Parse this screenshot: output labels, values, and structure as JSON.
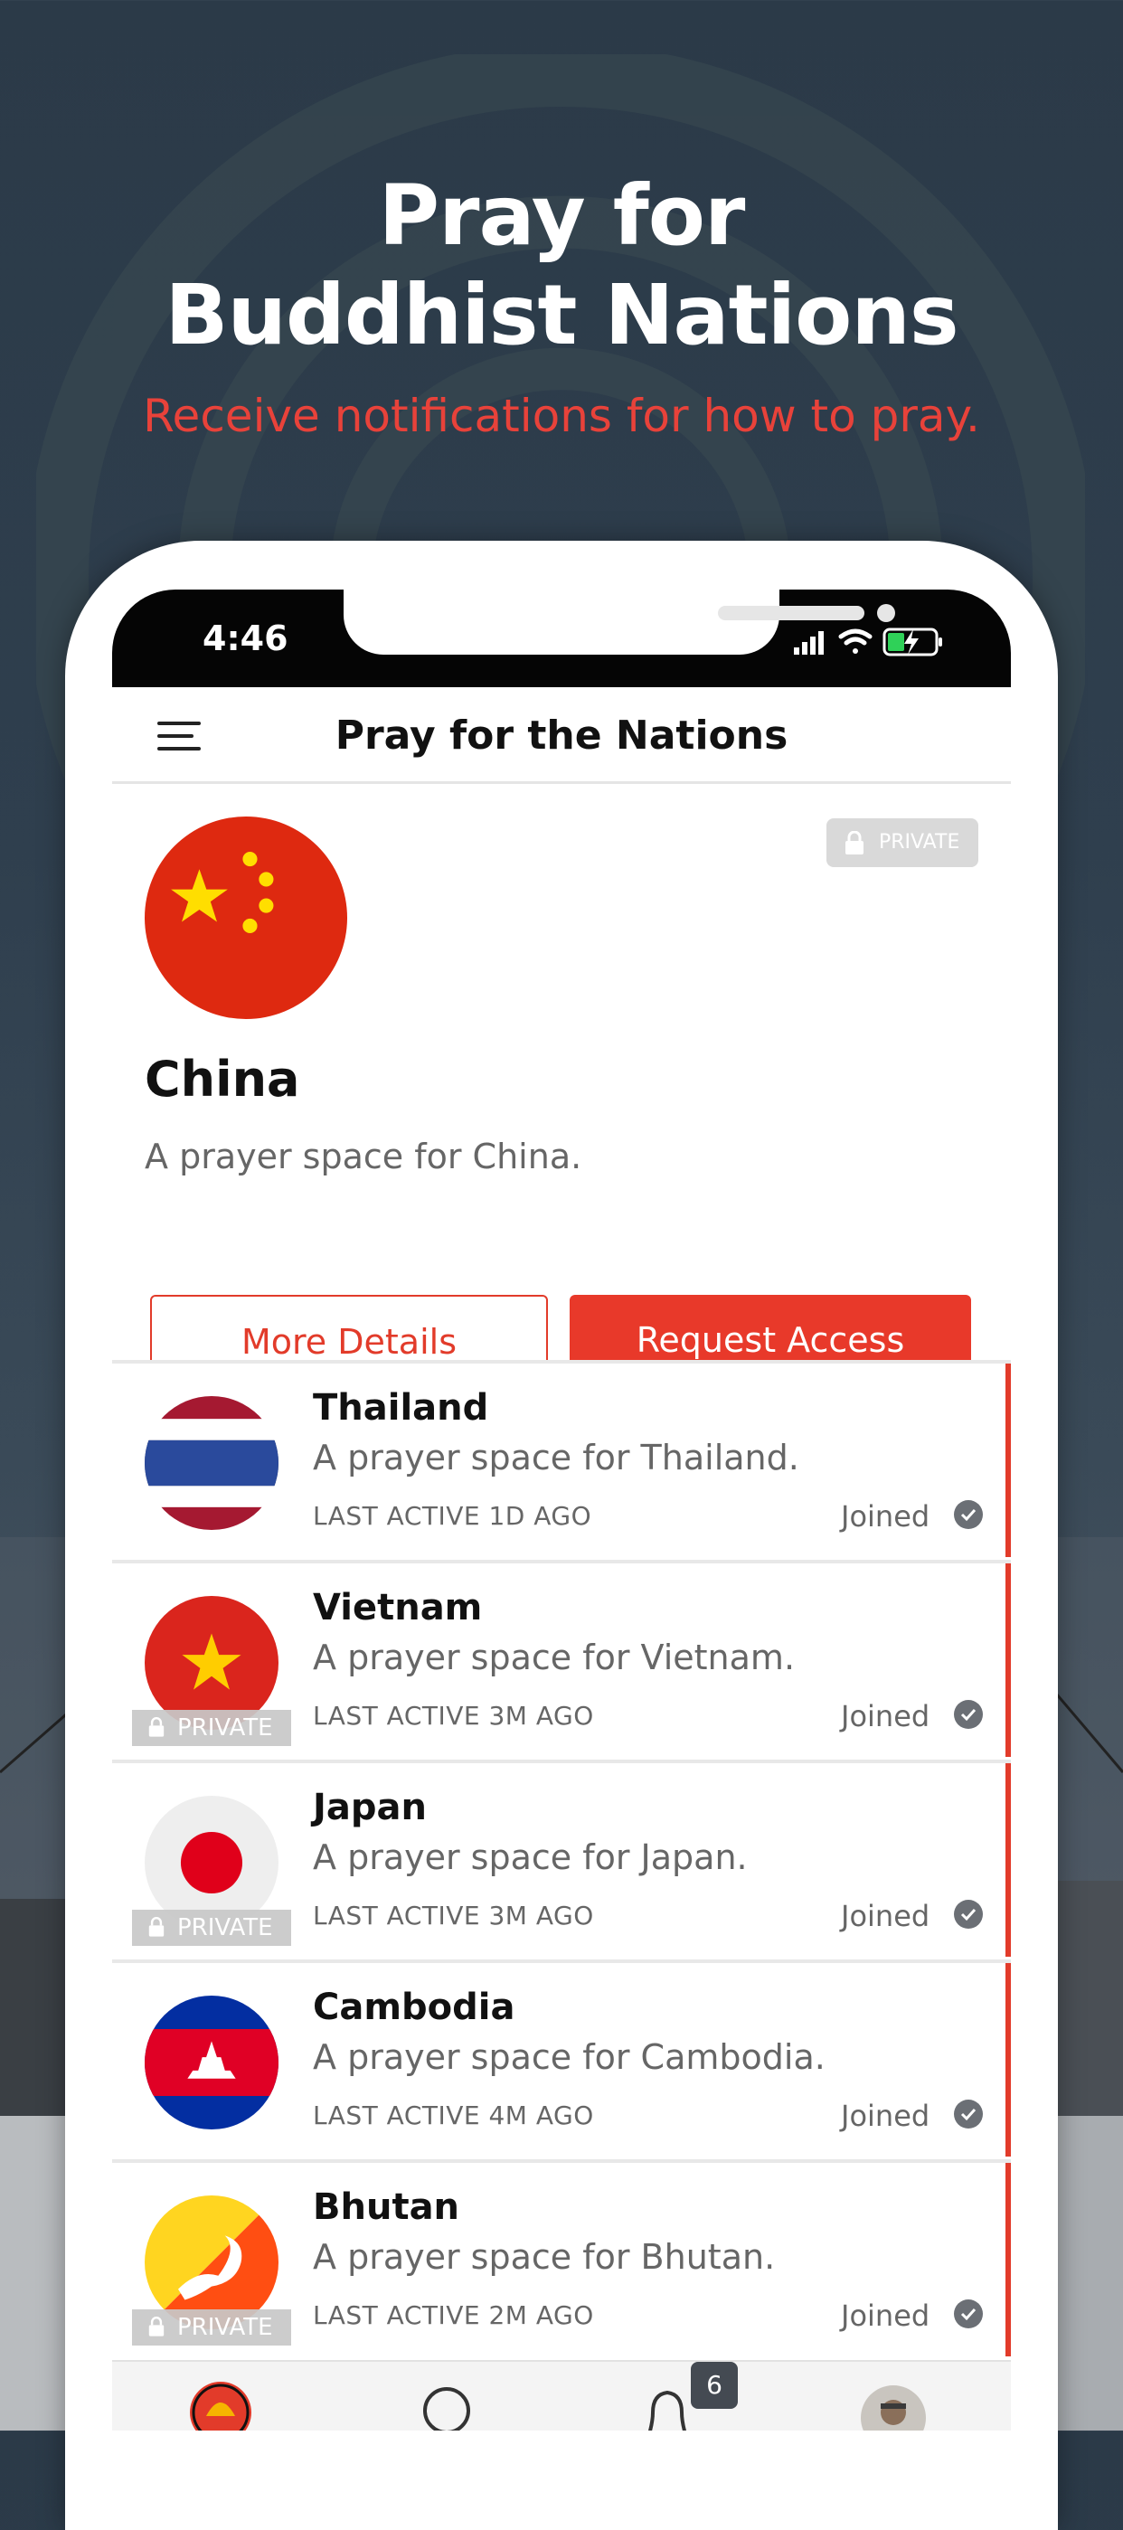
{
  "hero": {
    "title_line1": "Pray for",
    "title_line2": "Buddhist Nations",
    "subtitle": "Receive notifications for how to pray."
  },
  "status_bar": {
    "time": "4:46"
  },
  "nav": {
    "title": "Pray for the Nations"
  },
  "featured": {
    "name": "China",
    "description": "A prayer space for China.",
    "private_label": "PRIVATE",
    "more_details_label": "More Details",
    "request_access_label": "Request Access"
  },
  "countries": [
    {
      "name": "Thailand",
      "description": "A prayer space for Thailand.",
      "last_active": "LAST ACTIVE 1D AGO",
      "status": "Joined",
      "private": false
    },
    {
      "name": "Vietnam",
      "description": "A prayer space for Vietnam.",
      "last_active": "LAST ACTIVE 3M AGO",
      "status": "Joined",
      "private": true,
      "private_label": "PRIVATE"
    },
    {
      "name": "Japan",
      "description": "A prayer space for Japan.",
      "last_active": "LAST ACTIVE 3M AGO",
      "status": "Joined",
      "private": true,
      "private_label": "PRIVATE"
    },
    {
      "name": "Cambodia",
      "description": "A prayer space for Cambodia.",
      "last_active": "LAST ACTIVE 4M AGO",
      "status": "Joined",
      "private": false
    },
    {
      "name": "Bhutan",
      "description": "A prayer space for Bhutan.",
      "last_active": "LAST ACTIVE 2M AGO",
      "status": "Joined",
      "private": true,
      "private_label": "PRIVATE"
    }
  ],
  "tabbar": {
    "notification_count": "6"
  },
  "colors": {
    "accent": "#e8392a",
    "hero_subtitle": "#e8423a",
    "background": "#2f3f4e"
  }
}
